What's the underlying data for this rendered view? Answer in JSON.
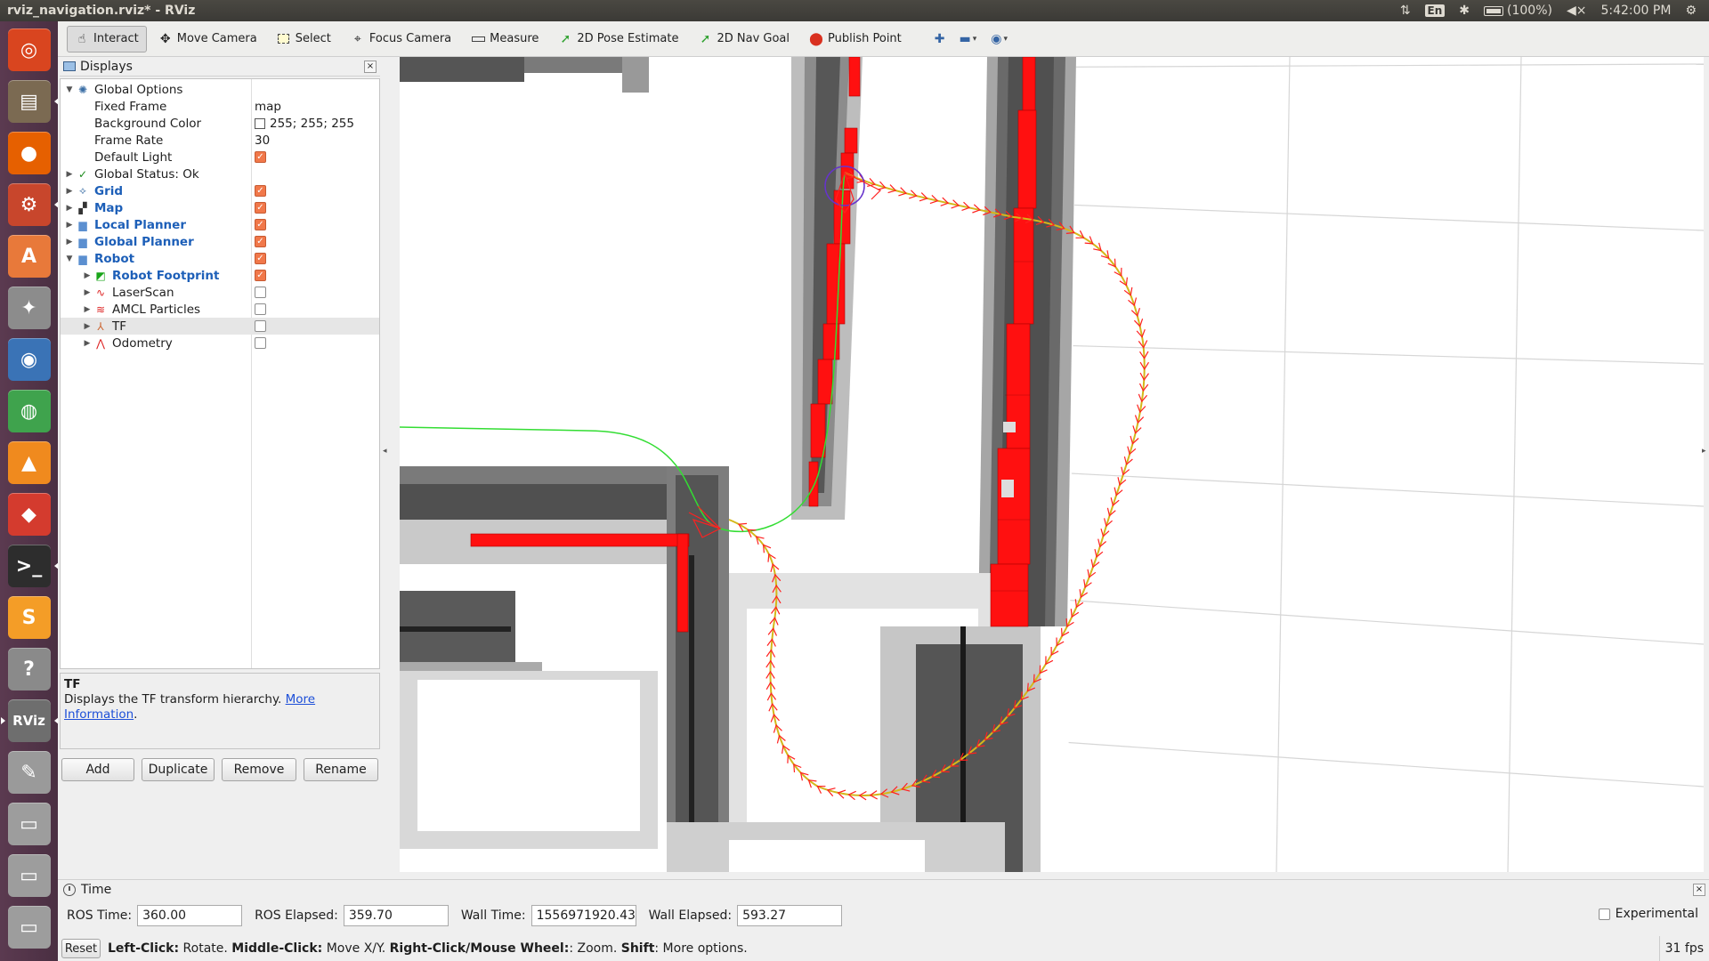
{
  "topbar": {
    "title": "rviz_navigation.rviz* - RViz",
    "lang": "En",
    "battery": "(100%)",
    "clock": "5:42:00 PM"
  },
  "launcher": {
    "items": [
      {
        "name": "ubuntu-dash-icon",
        "glyph": "◎",
        "color": "#d9451f"
      },
      {
        "name": "files-icon",
        "glyph": "▤",
        "color": "#7b6a52"
      },
      {
        "name": "firefox-icon",
        "glyph": "●",
        "color": "#e66000"
      },
      {
        "name": "tweak-tool-icon",
        "glyph": "⚙",
        "color": "#c8462c"
      },
      {
        "name": "software-center-icon",
        "glyph": "A",
        "color": "#e8793a"
      },
      {
        "name": "system-settings-icon",
        "glyph": "✦",
        "color": "#8c8c8c"
      },
      {
        "name": "earth-icon",
        "glyph": "◉",
        "color": "#3a73b6"
      },
      {
        "name": "network-icon",
        "glyph": "◍",
        "color": "#3fa34d"
      },
      {
        "name": "vlc-icon",
        "glyph": "▲",
        "color": "#f08a1e"
      },
      {
        "name": "git-icon",
        "glyph": "◆",
        "color": "#d43b2e"
      },
      {
        "name": "terminal-icon",
        "glyph": ">_",
        "color": "#2d2d2d"
      },
      {
        "name": "sublime-icon",
        "glyph": "S",
        "color": "#f49d27"
      },
      {
        "name": "help-icon",
        "glyph": "?",
        "color": "#8a8a8a"
      },
      {
        "name": "rviz-icon",
        "glyph": "RViz",
        "color": "#6e6e6e"
      },
      {
        "name": "text-editor-icon",
        "glyph": "✎",
        "color": "#9a9a9a"
      },
      {
        "name": "disk-icon",
        "glyph": "▭",
        "color": "#9d9d9d"
      },
      {
        "name": "disk2-icon",
        "glyph": "▭",
        "color": "#9d9d9d"
      },
      {
        "name": "disk3-icon",
        "glyph": "▭",
        "color": "#9d9d9d"
      }
    ]
  },
  "toolbar": {
    "interact": "Interact",
    "move_camera": "Move Camera",
    "select": "Select",
    "focus_camera": "Focus Camera",
    "measure": "Measure",
    "pose_estimate": "2D Pose Estimate",
    "nav_goal": "2D Nav Goal",
    "publish_point": "Publish Point"
  },
  "displays": {
    "title": "Displays",
    "global_options": "Global Options",
    "fixed_frame_label": "Fixed Frame",
    "fixed_frame_value": "map",
    "bg_color_label": "Background Color",
    "bg_color_value": "255; 255; 255",
    "frame_rate_label": "Frame Rate",
    "frame_rate_value": "30",
    "default_light_label": "Default Light",
    "global_status": "Global Status: Ok",
    "grid": "Grid",
    "map": "Map",
    "local_planner": "Local Planner",
    "global_planner": "Global Planner",
    "robot": "Robot",
    "robot_footprint": "Robot Footprint",
    "laserscan": "LaserScan",
    "amcl_particles": "AMCL Particles",
    "tf": "TF",
    "odometry": "Odometry"
  },
  "description": {
    "title": "TF",
    "text": "Displays the TF transform hierarchy. ",
    "link1": "More",
    "link2": "Information",
    "period": "."
  },
  "panel_buttons": {
    "add": "Add",
    "duplicate": "Duplicate",
    "remove": "Remove",
    "rename": "Rename"
  },
  "time": {
    "title": "Time",
    "ros_time_label": "ROS Time:",
    "ros_time": "360.00",
    "ros_elapsed_label": "ROS Elapsed:",
    "ros_elapsed": "359.70",
    "wall_time_label": "Wall Time:",
    "wall_time": "1556971920.43",
    "wall_elapsed_label": "Wall Elapsed:",
    "wall_elapsed": "593.27",
    "experimental": "Experimental"
  },
  "status": {
    "reset": "Reset",
    "k1": "Left-Click:",
    "v1": " Rotate. ",
    "k2": "Middle-Click:",
    "v2": " Move X/Y. ",
    "k3": "Right-Click/Mouse Wheel:",
    "v3": ": Zoom. ",
    "k4": "Shift",
    "v4": ": More options.",
    "fps": "31 fps"
  },
  "colors": {
    "obstacle": "#ff0000",
    "path": "#33dd33",
    "pose_arrows": "#ff2020",
    "local_plan": "#d4b81a",
    "check_on": "#f1784a",
    "footprint": "#6633cc"
  }
}
